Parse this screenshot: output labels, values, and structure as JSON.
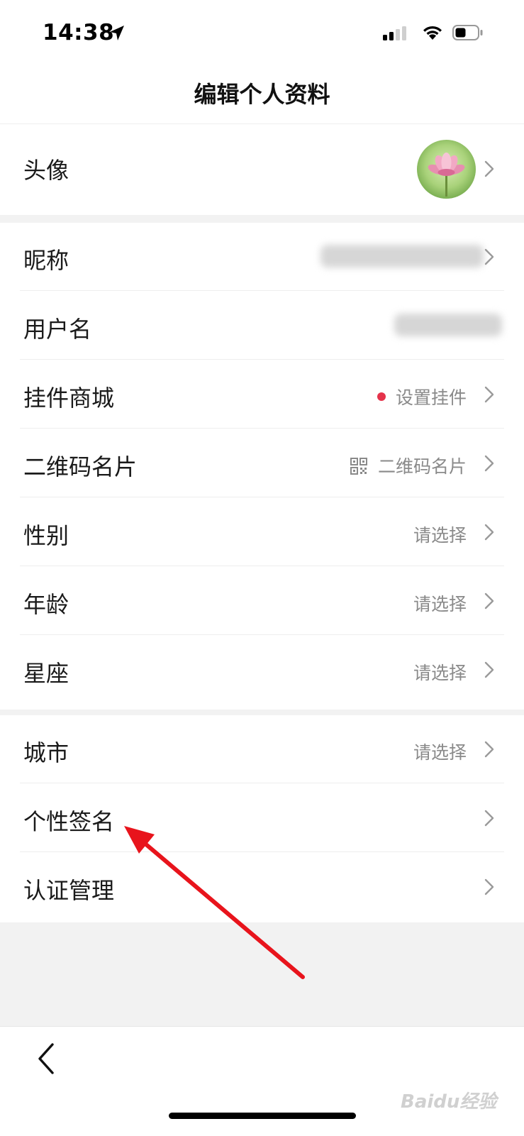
{
  "status_bar": {
    "time": "14:38",
    "location_icon": "location-arrow-icon",
    "signal_icon": "cellular-signal-icon",
    "wifi_icon": "wifi-icon",
    "battery_icon": "battery-icon"
  },
  "nav": {
    "title": "编辑个人资料"
  },
  "profile": {
    "avatar_label": "头像",
    "nickname_label": "昵称",
    "username_label": "用户名",
    "pendant_label": "挂件商城",
    "pendant_value": "设置挂件",
    "qrcode_label": "二维码名片",
    "qrcode_value": "二维码名片",
    "gender_label": "性别",
    "gender_value": "请选择",
    "age_label": "年龄",
    "age_value": "请选择",
    "constellation_label": "星座",
    "constellation_value": "请选择",
    "city_label": "城市",
    "city_value": "请选择",
    "signature_label": "个性签名",
    "verify_label": "认证管理"
  },
  "bottom": {
    "back_icon": "chevron-left-icon"
  },
  "watermark": "Baidu经验",
  "colors": {
    "accent_dot": "#e5334b",
    "annotation_arrow": "#e8141c"
  }
}
